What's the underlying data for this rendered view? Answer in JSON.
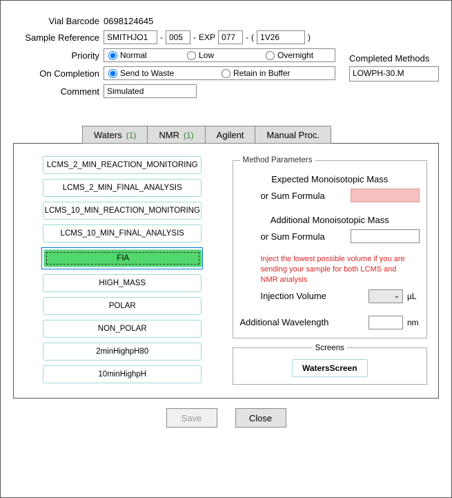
{
  "vial_barcode_label": "Vial Barcode",
  "vial_barcode_value": "0698124645",
  "sample_reference_label": "Sample Reference",
  "sample_ref": {
    "a": "SMITHJO1",
    "b": "005",
    "exp_label": "EXP",
    "c": "077",
    "d": "1V26",
    "sep": "-",
    "paren_open": "(",
    "paren_close": ")"
  },
  "priority_label": "Priority",
  "priority_options": [
    "Normal",
    "Low",
    "Overnight"
  ],
  "priority_selected": 0,
  "on_completion_label": "On Completion",
  "on_completion_options": [
    "Send to Waste",
    "Retain in Buffer"
  ],
  "on_completion_selected": 0,
  "comment_label": "Comment",
  "comment_value": "Simulated",
  "completed_methods_label": "Completed Methods",
  "completed_methods_value": "LOWPH-30.M",
  "tabs": [
    {
      "label": "Waters",
      "badge": "(1)"
    },
    {
      "label": "NMR",
      "badge": "(1)"
    },
    {
      "label": "Agilent",
      "badge": ""
    },
    {
      "label": "Manual Proc.",
      "badge": ""
    }
  ],
  "methods": [
    "LCMS_2_MIN_REACTION_MONITORING",
    "LCMS_2_MIN_FINAL_ANALYSIS",
    "LCMS_10_MIN_REACTION_MONITORING",
    "LCMS_10_MIN_FINAL_ANALYSIS",
    "FIA",
    "HIGH_MASS",
    "POLAR",
    "NON_POLAR",
    "2minHighpH80",
    "10minHighpH"
  ],
  "methods_selected_index": 4,
  "params": {
    "legend": "Method Parameters",
    "expected_mass_label": "Expected Monoisotopic Mass",
    "or_sum_label": "or Sum Formula",
    "additional_mass_label": "Additional Monoisotopic Mass",
    "note": "Inject the lowest possible volume if you are sending your sample for both LCMS and NMR analysis",
    "injection_volume_label": "Injection Volume",
    "injection_unit": "µL",
    "additional_wavelength_label": "Additional Wavelength",
    "wavelength_unit": "nm"
  },
  "screens": {
    "legend": "Screens",
    "button": "WatersScreen"
  },
  "actions": {
    "save": "Save",
    "close": "Close"
  }
}
